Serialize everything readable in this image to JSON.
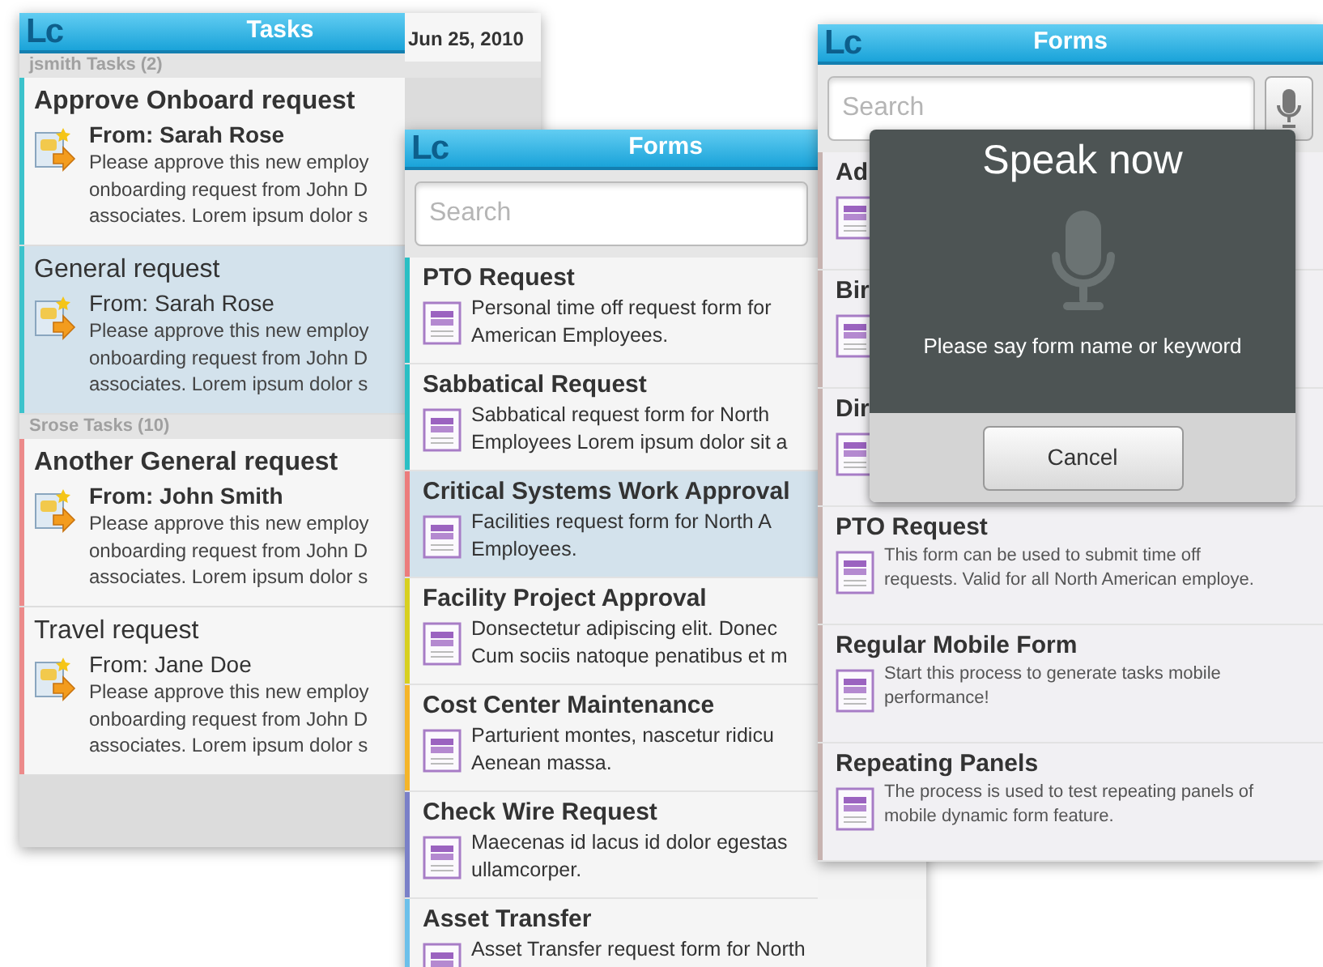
{
  "tasks_screen": {
    "logo": "Lc",
    "title": "Tasks",
    "groups": [
      {
        "label": "jsmith Tasks (2)",
        "color": "#3cc3cc",
        "tasks": [
          {
            "title": "Approve Onboard request",
            "unread": true,
            "selected": false,
            "date": "Jun 25, 2010",
            "sender": "From: Sarah Rose",
            "description": "Please approve this new employ\nonboarding request from John D\nassociates. Lorem ipsum dolor s"
          },
          {
            "title": "General request",
            "unread": false,
            "selected": true,
            "sender": "From: Sarah Rose",
            "description": "Please approve this new employ\nonboarding request from John D\nassociates. Lorem ipsum dolor s"
          }
        ]
      },
      {
        "label": "Srose Tasks (10)",
        "color": "#ec8a8a",
        "tasks": [
          {
            "title": "Another General request",
            "unread": true,
            "selected": false,
            "sender": "From: John Smith",
            "description": "Please approve this new employ\nonboarding request from John D\nassociates. Lorem ipsum dolor s"
          },
          {
            "title": "Travel request",
            "unread": false,
            "selected": false,
            "sender": "From: Jane Doe",
            "description": "Please approve this new employ\nonboarding request from John D\nassociates. Lorem ipsum dolor s"
          }
        ]
      }
    ]
  },
  "forms_screen": {
    "logo": "Lc",
    "title": "Forms",
    "search": {
      "placeholder": "Search"
    },
    "forms": [
      {
        "title": "PTO Request",
        "description": "Personal time off request form for\nAmerican Employees.",
        "color": "#2bbfc4",
        "selected": false
      },
      {
        "title": "Sabbatical Request",
        "description": "Sabbatical request form for North\nEmployees Lorem ipsum dolor sit a",
        "color": "#2bbfc4",
        "selected": false
      },
      {
        "title": "Critical Systems Work Approval",
        "description": "Facilities request form for North A\nEmployees.",
        "color": "#ec7c7c",
        "selected": true
      },
      {
        "title": "Facility Project Approval",
        "description": "Donsectetur adipiscing elit. Donec\nCum sociis natoque penatibus et m",
        "color": "#d8d020",
        "selected": false
      },
      {
        "title": "Cost Center Maintenance",
        "description": "Parturient montes, nascetur ridicu\nAenean massa.",
        "color": "#f5b52a",
        "selected": false
      },
      {
        "title": "Check Wire Request",
        "description": "Maecenas id lacus id dolor egestas\nullamcorper.",
        "color": "#7a80c8",
        "selected": false
      },
      {
        "title": "Asset Transfer",
        "description": "Asset Transfer request form for North",
        "color": "#6cc0ea",
        "selected": false
      }
    ]
  },
  "voice_search_screen": {
    "logo": "Lc",
    "title": "Forms",
    "search": {
      "placeholder": "Search"
    },
    "forms": [
      {
        "title": "Ad"
      },
      {
        "title": "Bir"
      },
      {
        "title": "Dir"
      },
      {
        "title": "PTO Request",
        "description": "This form can be used to submit time off\nrequests. Valid for all North American employe."
      },
      {
        "title": "Regular Mobile Form",
        "description": "Start this process to generate tasks mobile\nperformance!"
      },
      {
        "title": "Repeating Panels",
        "description": "The process is used to test repeating panels of\nmobile dynamic form feature."
      }
    ],
    "dialog": {
      "title": "Speak now",
      "prompt": "Please say form name or keyword",
      "button": "Cancel"
    }
  }
}
